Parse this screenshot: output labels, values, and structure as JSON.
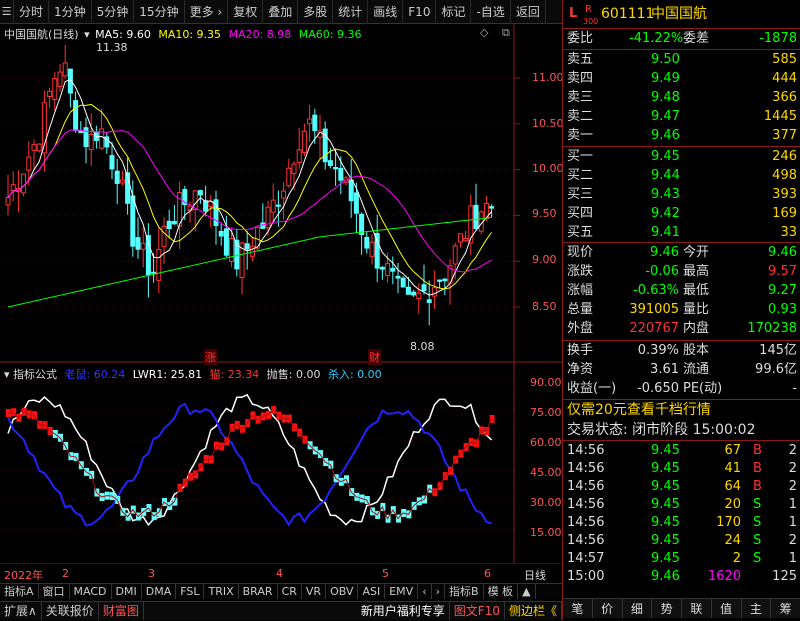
{
  "toolbar": {
    "items": [
      "分时",
      "1分钟",
      "5分钟",
      "15分钟",
      "更多 ›",
      "复权",
      "叠加",
      "多股",
      "统计",
      "画线",
      "F10",
      "标记",
      "-自选",
      "返回"
    ]
  },
  "main_chart": {
    "title": "中国国航(日线)",
    "ma5": "MA5: 9.60",
    "ma10": "MA10: 9.35",
    "ma20": "MA20: 8.98",
    "ma60": "MA60: 9.36",
    "high_label": "11.38",
    "low_label": "8.08",
    "marker_zhang": "涨",
    "marker_cai": "财",
    "price_axis": [
      "11.00",
      "10.50",
      "10.00",
      "9.50",
      "9.00",
      "8.50"
    ],
    "colors": {
      "ma5": "#ffffff",
      "ma10": "#ffff00",
      "ma20": "#ff00ff",
      "ma60": "#00ff00",
      "up": "#ff3232",
      "down": "#54ffff"
    }
  },
  "indicator": {
    "label": "指标公式",
    "s1": "老鼠: 60.24",
    "s2": "LWR1: 25.81",
    "s3": "猫: 23.34",
    "s4": "抛售: 0.00",
    "s5": "杀入: 0.00",
    "axis": [
      "90.00",
      "75.00",
      "60.00",
      "45.00",
      "30.00",
      "15.00"
    ]
  },
  "timeline": {
    "labels": [
      "2022年",
      "2",
      "3",
      "4",
      "5",
      "6"
    ],
    "period": "日线"
  },
  "bottom_tabs1": [
    "指标A",
    "窗口",
    "MACD",
    "DMI",
    "DMA",
    "FSL",
    "TRIX",
    "BRAR",
    "CR",
    "VR",
    "OBV",
    "ASI",
    "EMV",
    "‹",
    "›",
    "指标B",
    "模 板",
    "▲"
  ],
  "bottom_tabs2": [
    "扩展∧",
    "关联报价",
    "财富图"
  ],
  "bottom_tabs2_right": [
    "新用户福利专享",
    "图文F10",
    "侧边栏《"
  ],
  "right_strip": [
    "笔",
    "价",
    "细",
    "势",
    "联",
    "值",
    "主",
    "筹"
  ],
  "stock": {
    "code": "601111",
    "name": "中国国航",
    "tag_l": "L",
    "tag_r": "R",
    "tag_300": "300"
  },
  "order_book": {
    "webi_label": "委比",
    "webi": "-41.22%",
    "wecha_label": "委差",
    "wecha": "-1878",
    "sells": [
      {
        "l": "卖五",
        "p": "9.50",
        "v": "585"
      },
      {
        "l": "卖四",
        "p": "9.49",
        "v": "444"
      },
      {
        "l": "卖三",
        "p": "9.48",
        "v": "366"
      },
      {
        "l": "卖二",
        "p": "9.47",
        "v": "1445"
      },
      {
        "l": "卖一",
        "p": "9.46",
        "v": "377"
      }
    ],
    "buys": [
      {
        "l": "买一",
        "p": "9.45",
        "v": "246"
      },
      {
        "l": "买二",
        "p": "9.44",
        "v": "498"
      },
      {
        "l": "买三",
        "p": "9.43",
        "v": "393"
      },
      {
        "l": "买四",
        "p": "9.42",
        "v": "169"
      },
      {
        "l": "买五",
        "p": "9.41",
        "v": "33"
      }
    ]
  },
  "quote": {
    "rows": [
      {
        "a": "现价",
        "av": "9.46",
        "b": "今开",
        "bv": "9.46"
      },
      {
        "a": "涨跌",
        "av": "-0.06",
        "b": "最高",
        "bv": "9.57"
      },
      {
        "a": "涨幅",
        "av": "-0.63%",
        "b": "最低",
        "bv": "9.27"
      },
      {
        "a": "总量",
        "av": "391005",
        "b": "量比",
        "bv": "0.93"
      },
      {
        "a": "外盘",
        "av": "220767",
        "b": "内盘",
        "bv": "170238"
      }
    ],
    "rows2": [
      {
        "a": "换手",
        "av": "0.39%",
        "b": "股本",
        "bv": "145亿"
      },
      {
        "a": "净资",
        "av": "3.61",
        "b": "流通",
        "bv": "99.6亿"
      },
      {
        "a": "收益(一)",
        "av": "-0.650",
        "b": "PE(动)",
        "bv": "-"
      }
    ]
  },
  "promo": "仅需20元查看千档行情",
  "trade_status": "交易状态: 闭市阶段 15:00:02",
  "ticks": [
    {
      "t": "14:56",
      "p": "9.45",
      "v": "67",
      "s": "B",
      "n": "2"
    },
    {
      "t": "14:56",
      "p": "9.45",
      "v": "41",
      "s": "B",
      "n": "2"
    },
    {
      "t": "14:56",
      "p": "9.45",
      "v": "64",
      "s": "B",
      "n": "2"
    },
    {
      "t": "14:56",
      "p": "9.45",
      "v": "20",
      "s": "S",
      "n": "1"
    },
    {
      "t": "14:56",
      "p": "9.45",
      "v": "170",
      "s": "S",
      "n": "1"
    },
    {
      "t": "14:56",
      "p": "9.45",
      "v": "24",
      "s": "S",
      "n": "2"
    },
    {
      "t": "14:57",
      "p": "9.45",
      "v": "2",
      "s": "S",
      "n": "1"
    },
    {
      "t": "15:00",
      "p": "9.46",
      "v": "1620",
      "s": "",
      "n": "125"
    }
  ]
}
